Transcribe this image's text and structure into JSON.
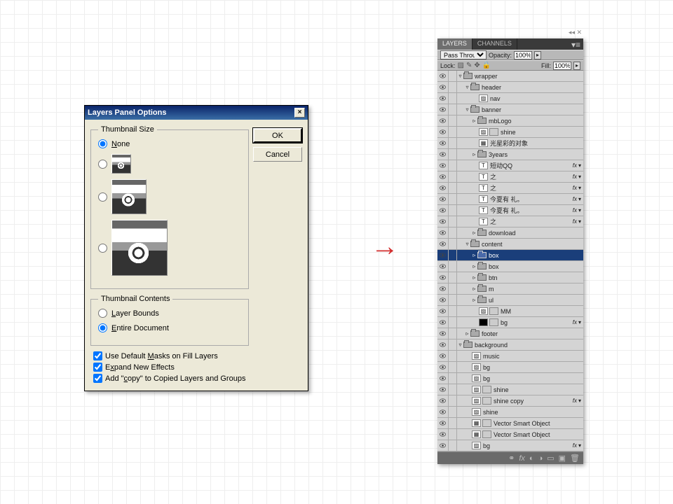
{
  "dialog": {
    "title": "Layers Panel Options",
    "fs1": "Thumbnail Size",
    "none": "None",
    "fs2": "Thumbnail Contents",
    "lb": "Layer Bounds",
    "ed": "Entire Document",
    "c1": "Use Default Masks on Fill Layers",
    "c2": "Expand New Effects",
    "c3": "Add \"copy\" to Copied Layers and Groups",
    "ok": "OK",
    "cancel": "Cancel"
  },
  "panel": {
    "tab1": "LAYERS",
    "tab2": "CHANNELS",
    "blend": "Pass Through",
    "opLbl": "Opacity:",
    "opVal": "100%",
    "lockLbl": "Lock:",
    "fillLbl": "Fill:",
    "fillVal": "100%"
  },
  "L": {
    "wrapper": "wrapper",
    "header": "header",
    "nav": "nav",
    "banner": "banner",
    "mbLogo": "mbLogo",
    "shine": "shine",
    "cntext": "光星彩的对象",
    "y3": "3years",
    "qq": "短动QQ",
    "zhi": "之",
    "jin": "今夏有   礼。",
    "download": "download",
    "content": "content",
    "box": "box",
    "btn": "btn",
    "m": "m",
    "ul": "ul",
    "MM": "MM",
    "bg": "bg",
    "footer": "footer",
    "background": "background",
    "music": "music",
    "shinecopy": "shine copy",
    "vso": "Vector Smart Object"
  }
}
